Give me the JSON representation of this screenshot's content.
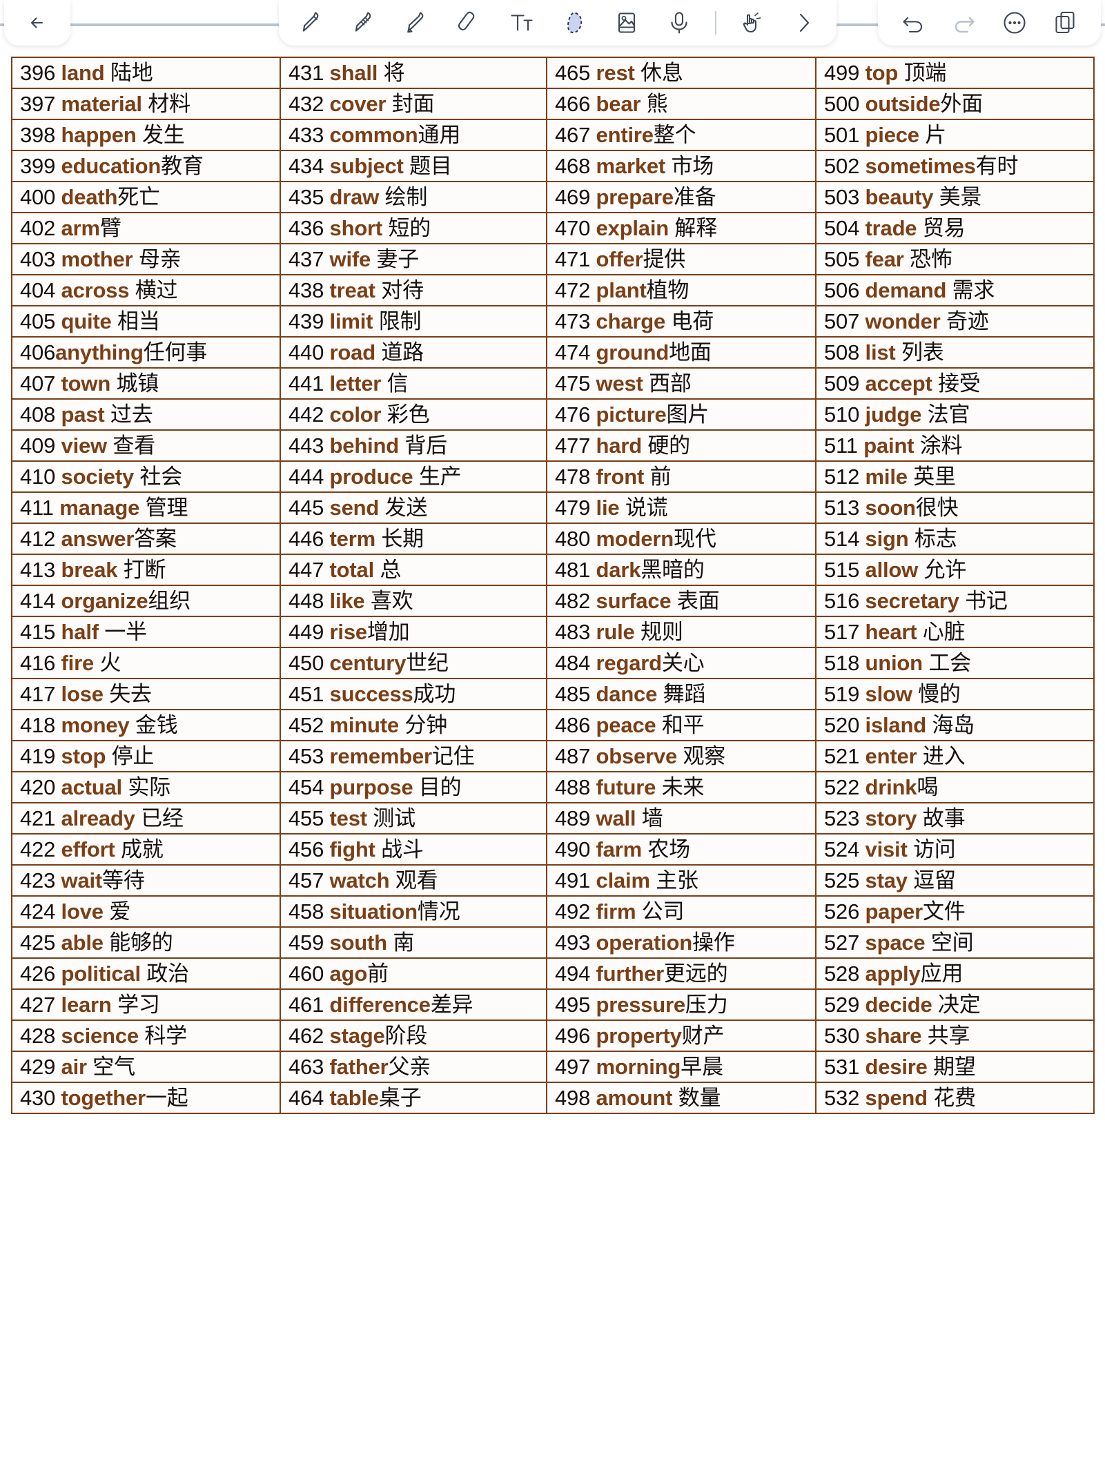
{
  "toolbar": {
    "back": {
      "icon": "back-arrow-icon",
      "label": "Back"
    },
    "tools": [
      {
        "name": "pen-tool",
        "icon": "pen-icon",
        "selected": false
      },
      {
        "name": "pencil-tool",
        "icon": "pencil-icon",
        "selected": false
      },
      {
        "name": "highlighter-tool",
        "icon": "highlighter-icon",
        "selected": false
      },
      {
        "name": "eraser-tool",
        "icon": "eraser-icon",
        "selected": false
      },
      {
        "name": "text-tool",
        "icon": "text-Tt-icon",
        "selected": false
      },
      {
        "name": "lasso-select-tool",
        "icon": "lasso-select-icon",
        "selected": true
      },
      {
        "name": "insert-image-tool",
        "icon": "image-icon",
        "selected": false
      },
      {
        "name": "voice-record-tool",
        "icon": "microphone-icon",
        "selected": false
      },
      {
        "name": "hand-pan-tool",
        "icon": "hand-pointer-icon",
        "selected": false
      },
      {
        "name": "more-tools",
        "icon": "chevron-right-icon",
        "selected": false
      }
    ],
    "right": [
      {
        "name": "undo",
        "icon": "undo-arrow-icon",
        "enabled": true
      },
      {
        "name": "redo",
        "icon": "redo-arrow-icon",
        "enabled": false
      },
      {
        "name": "more-menu",
        "icon": "ellipsis-circle-icon",
        "enabled": true
      },
      {
        "name": "pages",
        "icon": "copy-pages-icon",
        "enabled": true
      }
    ]
  },
  "colors": {
    "word_brown": "#7b3f17",
    "border_brown": "#7a3f18",
    "number_black": "#14100d",
    "page_background": "#fdfcfa",
    "toolbar_rule": "#b9c3d1"
  },
  "table": {
    "columns": 4,
    "rows": 34,
    "cells": [
      [
        {
          "num": "396",
          "en": "land",
          "zh": "陆地",
          "sep": " "
        },
        {
          "num": "431",
          "en": "shall",
          "zh": "将",
          "sep": " "
        },
        {
          "num": "465",
          "en": "rest",
          "zh": "休息",
          "sep": " "
        },
        {
          "num": "499",
          "en": "top",
          "zh": "顶端",
          "sep": " "
        }
      ],
      [
        {
          "num": "397",
          "en": "material",
          "zh": "材料",
          "sep": " "
        },
        {
          "num": "432",
          "en": "cover",
          "zh": "封面",
          "sep": " "
        },
        {
          "num": "466",
          "en": "bear",
          "zh": "熊",
          "sep": " "
        },
        {
          "num": "500",
          "en": "outside",
          "zh": "外面",
          "sep": ""
        }
      ],
      [
        {
          "num": "398",
          "en": "happen",
          "zh": "发生",
          "sep": " "
        },
        {
          "num": "433",
          "en": "common",
          "zh": "通用",
          "sep": ""
        },
        {
          "num": "467",
          "en": "entire",
          "zh": "整个",
          "sep": ""
        },
        {
          "num": "501",
          "en": "piece",
          "zh": "片",
          "sep": " "
        }
      ],
      [
        {
          "num": "399",
          "en": "education",
          "zh": "教育",
          "sep": ""
        },
        {
          "num": "434",
          "en": "subject",
          "zh": "题目",
          "sep": " "
        },
        {
          "num": "468",
          "en": "market",
          "zh": "市场",
          "sep": " "
        },
        {
          "num": "502",
          "en": "sometimes",
          "zh": "有时",
          "sep": ""
        }
      ],
      [
        {
          "num": "400",
          "en": "death",
          "zh": "死亡",
          "sep": ""
        },
        {
          "num": "435",
          "en": "draw",
          "zh": "绘制",
          "sep": " "
        },
        {
          "num": "469",
          "en": "prepare",
          "zh": "准备",
          "sep": ""
        },
        {
          "num": "503",
          "en": "beauty",
          "zh": "美景",
          "sep": " "
        }
      ],
      [
        {
          "num": "402",
          "en": "arm",
          "zh": "臂",
          "sep": ""
        },
        {
          "num": "436",
          "en": "short",
          "zh": "短的",
          "sep": " "
        },
        {
          "num": "470",
          "en": "explain",
          "zh": "解释",
          "sep": " "
        },
        {
          "num": "504",
          "en": "trade",
          "zh": "贸易",
          "sep": " "
        }
      ],
      [
        {
          "num": "403",
          "en": "mother",
          "zh": "母亲",
          "sep": " "
        },
        {
          "num": "437",
          "en": "wife",
          "zh": "妻子",
          "sep": " "
        },
        {
          "num": "471",
          "en": "offer",
          "zh": "提供",
          "sep": ""
        },
        {
          "num": "505",
          "en": "fear",
          "zh": "恐怖",
          "sep": " "
        }
      ],
      [
        {
          "num": "404",
          "en": "across",
          "zh": "横过",
          "sep": "  "
        },
        {
          "num": "438",
          "en": "treat",
          "zh": "对待",
          "sep": " "
        },
        {
          "num": "472",
          "en": "plant",
          "zh": "植物",
          "sep": ""
        },
        {
          "num": "506",
          "en": "demand",
          "zh": "需求",
          "sep": " "
        }
      ],
      [
        {
          "num": "405",
          "en": "quite",
          "zh": "相当",
          "sep": " "
        },
        {
          "num": "439",
          "en": "limit",
          "zh": "限制",
          "sep": " "
        },
        {
          "num": "473",
          "en": "charge",
          "zh": "电荷",
          "sep": " "
        },
        {
          "num": "507",
          "en": "wonder",
          "zh": "奇迹",
          "sep": " "
        }
      ],
      [
        {
          "num": "406",
          "en": "anything",
          "zh": "任何事",
          "sep": "",
          "numsep": ""
        },
        {
          "num": "440",
          "en": "road",
          "zh": "道路",
          "sep": " "
        },
        {
          "num": "474",
          "en": "ground",
          "zh": "地面",
          "sep": ""
        },
        {
          "num": "508",
          "en": "list",
          "zh": "列表",
          "sep": "  "
        }
      ],
      [
        {
          "num": "407",
          "en": "town",
          "zh": "城镇",
          "sep": " "
        },
        {
          "num": "441",
          "en": "letter",
          "zh": "信",
          "sep": " "
        },
        {
          "num": "475",
          "en": "west",
          "zh": "西部",
          "sep": " "
        },
        {
          "num": "509",
          "en": "accept",
          "zh": "接受",
          "sep": " "
        }
      ],
      [
        {
          "num": "408",
          "en": "past",
          "zh": "过去",
          "sep": " "
        },
        {
          "num": "442",
          "en": "color",
          "zh": "彩色",
          "sep": " "
        },
        {
          "num": "476",
          "en": "picture",
          "zh": "图片",
          "sep": ""
        },
        {
          "num": "510",
          "en": "judge",
          "zh": "法官",
          "sep": " "
        }
      ],
      [
        {
          "num": "409",
          "en": "view",
          "zh": "查看",
          "sep": " "
        },
        {
          "num": "443",
          "en": "behind",
          "zh": "背后",
          "sep": " "
        },
        {
          "num": "477",
          "en": "hard",
          "zh": "硬的",
          "sep": " "
        },
        {
          "num": "511",
          "en": "paint",
          "zh": "涂料",
          "sep": " "
        }
      ],
      [
        {
          "num": "410",
          "en": "society",
          "zh": "社会",
          "sep": " "
        },
        {
          "num": "444",
          "en": "produce",
          "zh": "生产",
          "sep": " "
        },
        {
          "num": "478",
          "en": "front",
          "zh": "前",
          "sep": " "
        },
        {
          "num": "512",
          "en": "mile",
          "zh": "英里",
          "sep": " "
        }
      ],
      [
        {
          "num": "411",
          "en": "manage",
          "zh": "管理",
          "sep": " "
        },
        {
          "num": "445",
          "en": "send",
          "zh": "发送",
          "sep": " "
        },
        {
          "num": "479",
          "en": "lie",
          "zh": "说谎",
          "sep": " "
        },
        {
          "num": "513",
          "en": "soon",
          "zh": "很快",
          "sep": ""
        }
      ],
      [
        {
          "num": "412",
          "en": "answer",
          "zh": "答案",
          "sep": ""
        },
        {
          "num": "446",
          "en": "term",
          "zh": "长期",
          "sep": " "
        },
        {
          "num": "480",
          "en": "modern",
          "zh": "现代",
          "sep": ""
        },
        {
          "num": "514",
          "en": "sign",
          "zh": "标志",
          "sep": " "
        }
      ],
      [
        {
          "num": "413",
          "en": "break",
          "zh": "打断",
          "sep": " "
        },
        {
          "num": "447",
          "en": "total",
          "zh": "总",
          "sep": " "
        },
        {
          "num": "481",
          "en": "dark",
          "zh": "黑暗的",
          "sep": ""
        },
        {
          "num": "515",
          "en": "allow",
          "zh": "允许",
          "sep": " "
        }
      ],
      [
        {
          "num": "414",
          "en": "organize",
          "zh": "组织",
          "sep": ""
        },
        {
          "num": "448",
          "en": "like",
          "zh": "喜欢",
          "sep": " "
        },
        {
          "num": "482",
          "en": "surface",
          "zh": "表面",
          "sep": " "
        },
        {
          "num": "516",
          "en": "secretary",
          "zh": "书记",
          "sep": " "
        }
      ],
      [
        {
          "num": "415",
          "en": "half",
          "zh": "一半",
          "sep": " "
        },
        {
          "num": "449",
          "en": "rise",
          "zh": "增加",
          "sep": ""
        },
        {
          "num": "483",
          "en": "rule",
          "zh": "规则",
          "sep": " "
        },
        {
          "num": "517",
          "en": "heart",
          "zh": "心脏",
          "sep": " "
        }
      ],
      [
        {
          "num": "416",
          "en": "fire",
          "zh": "火",
          "sep": " "
        },
        {
          "num": "450",
          "en": "century",
          "zh": "世纪",
          "sep": ""
        },
        {
          "num": "484",
          "en": "regard",
          "zh": "关心",
          "sep": ""
        },
        {
          "num": "518",
          "en": "union",
          "zh": "工会",
          "sep": " "
        }
      ],
      [
        {
          "num": "417",
          "en": "lose",
          "zh": "失去",
          "sep": " "
        },
        {
          "num": "451",
          "en": "success",
          "zh": "成功",
          "sep": ""
        },
        {
          "num": "485",
          "en": "dance",
          "zh": "舞蹈",
          "sep": " "
        },
        {
          "num": "519",
          "en": "slow",
          "zh": "慢的",
          "sep": " "
        }
      ],
      [
        {
          "num": "418",
          "en": "money",
          "zh": "金钱",
          "sep": " "
        },
        {
          "num": "452",
          "en": "minute",
          "zh": "分钟",
          "sep": " "
        },
        {
          "num": "486",
          "en": "peace",
          "zh": "和平",
          "sep": " "
        },
        {
          "num": "520",
          "en": "island",
          "zh": "海岛",
          "sep": " "
        }
      ],
      [
        {
          "num": "419",
          "en": "stop",
          "zh": "停止",
          "sep": " "
        },
        {
          "num": "453",
          "en": "remember",
          "zh": "记住",
          "sep": ""
        },
        {
          "num": "487",
          "en": "observe",
          "zh": "观察",
          "sep": " "
        },
        {
          "num": "521",
          "en": "enter",
          "zh": "进入",
          "sep": " "
        }
      ],
      [
        {
          "num": "420",
          "en": "actual",
          "zh": "实际",
          "sep": " "
        },
        {
          "num": "454",
          "en": "purpose",
          "zh": "目的",
          "sep": " "
        },
        {
          "num": "488",
          "en": "future",
          "zh": "未来",
          "sep": " "
        },
        {
          "num": "522",
          "en": "drink",
          "zh": "喝",
          "sep": ""
        }
      ],
      [
        {
          "num": "421",
          "en": "already",
          "zh": "已经",
          "sep": " "
        },
        {
          "num": "455",
          "en": "test",
          "zh": "测试",
          "sep": " "
        },
        {
          "num": "489",
          "en": "wall",
          "zh": "墙",
          "sep": " "
        },
        {
          "num": "523",
          "en": "story",
          "zh": "故事",
          "sep": " "
        }
      ],
      [
        {
          "num": "422",
          "en": "effort",
          "zh": "成就",
          "sep": " "
        },
        {
          "num": "456",
          "en": "fight",
          "zh": "战斗",
          "sep": " "
        },
        {
          "num": "490",
          "en": "farm",
          "zh": "农场",
          "sep": " "
        },
        {
          "num": "524",
          "en": "visit",
          "zh": "访问",
          "sep": " "
        }
      ],
      [
        {
          "num": "423",
          "en": "wait",
          "zh": "等待",
          "sep": ""
        },
        {
          "num": "457",
          "en": "watch",
          "zh": "观看",
          "sep": " "
        },
        {
          "num": "491",
          "en": "claim",
          "zh": "主张",
          "sep": " "
        },
        {
          "num": "525",
          "en": "stay",
          "zh": "逗留",
          "sep": " "
        }
      ],
      [
        {
          "num": "424",
          "en": "love",
          "zh": "爱",
          "sep": " "
        },
        {
          "num": "458",
          "en": "situation",
          "zh": "情况",
          "sep": ""
        },
        {
          "num": "492",
          "en": "firm",
          "zh": "公司",
          "sep": " "
        },
        {
          "num": "526",
          "en": "paper",
          "zh": "文件",
          "sep": ""
        }
      ],
      [
        {
          "num": "425",
          "en": "able",
          "zh": "能够的",
          "sep": " "
        },
        {
          "num": "459",
          "en": "south",
          "zh": "南",
          "sep": " "
        },
        {
          "num": "493",
          "en": "operation",
          "zh": "操作",
          "sep": ""
        },
        {
          "num": "527",
          "en": "space",
          "zh": "空间",
          "sep": " "
        }
      ],
      [
        {
          "num": "426",
          "en": "political",
          "zh": "政治",
          "sep": " "
        },
        {
          "num": "460",
          "en": "ago",
          "zh": "前",
          "sep": ""
        },
        {
          "num": "494",
          "en": "further",
          "zh": "更远的",
          "sep": ""
        },
        {
          "num": "528",
          "en": "apply",
          "zh": "应用",
          "sep": ""
        }
      ],
      [
        {
          "num": "427",
          "en": "learn",
          "zh": "学习",
          "sep": " "
        },
        {
          "num": "461",
          "en": "difference",
          "zh": "差异",
          "sep": ""
        },
        {
          "num": "495",
          "en": "pressure",
          "zh": "压力",
          "sep": ""
        },
        {
          "num": "529",
          "en": "decide",
          "zh": "决定",
          "sep": " "
        }
      ],
      [
        {
          "num": "428",
          "en": "science",
          "zh": "科学",
          "sep": " "
        },
        {
          "num": "462",
          "en": "stage",
          "zh": "阶段",
          "sep": ""
        },
        {
          "num": "496",
          "en": "property",
          "zh": "财产",
          "sep": ""
        },
        {
          "num": "530",
          "en": "share",
          "zh": "共享",
          "sep": " "
        }
      ],
      [
        {
          "num": "429",
          "en": "air",
          "zh": "空气",
          "sep": "  "
        },
        {
          "num": "463",
          "en": "father",
          "zh": "父亲",
          "sep": ""
        },
        {
          "num": "497",
          "en": "morning",
          "zh": "早晨",
          "sep": ""
        },
        {
          "num": "531",
          "en": "desire",
          "zh": "期望",
          "sep": " "
        }
      ],
      [
        {
          "num": "430",
          "en": "together",
          "zh": "一起",
          "sep": ""
        },
        {
          "num": "464",
          "en": "table",
          "zh": "桌子",
          "sep": ""
        },
        {
          "num": "498",
          "en": "amount",
          "zh": "数量",
          "sep": "  "
        },
        {
          "num": "532",
          "en": "spend",
          "zh": "花费",
          "sep": " "
        }
      ]
    ]
  }
}
